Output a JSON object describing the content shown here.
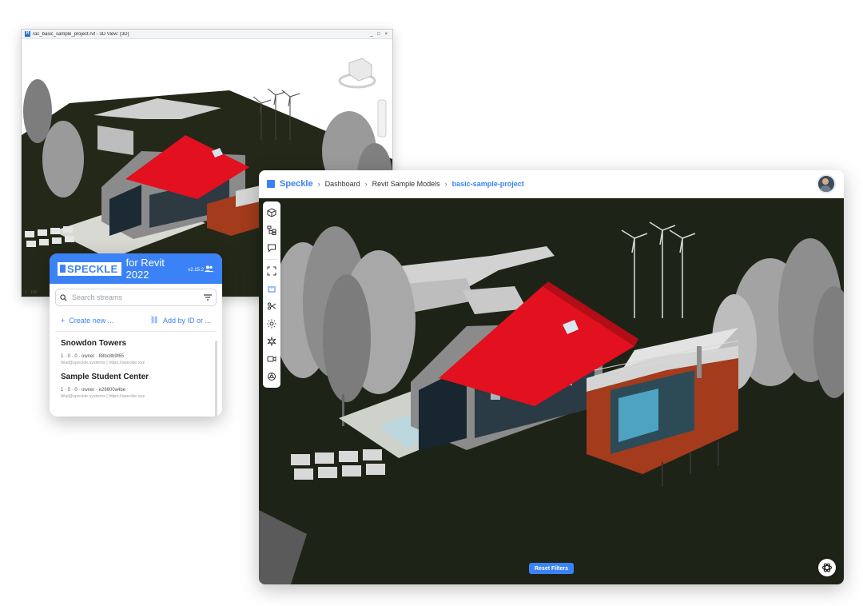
{
  "revit": {
    "window_title": "rac_basic_sample_project.rvt - 3D View: {3D}",
    "window_controls": "_ □ ×",
    "status_scale": "1 : 100"
  },
  "speckle_panel": {
    "logo": "SPECKLE",
    "product": "for Revit 2022",
    "version": "v2.15.2",
    "search_placeholder": "Search streams",
    "create_label": "Create new ...",
    "add_label": "Add by ID or ...",
    "streams": [
      {
        "name": "Snowdon Towers",
        "meta": "1 · 0 · 0 · owner · 88bc8b9f65",
        "user": "bilal@speckle.systems | https://speckle.xyz"
      },
      {
        "name": "Sample Student Center",
        "meta": "1 · 0 · 0 · owner · e28600a4be",
        "user": "bilal@speckle.systems | https://speckle.xyz"
      }
    ]
  },
  "viewer": {
    "brand": "Speckle",
    "breadcrumbs": [
      "Dashboard",
      "Revit Sample Models",
      "basic-sample-project"
    ],
    "reset_filters": "Reset Filters",
    "tools": [
      "cube-icon",
      "tree-icon",
      "comment-icon",
      "zoom-extents-icon",
      "measure-icon",
      "section-icon",
      "sun-icon",
      "explode-icon",
      "camera-icon",
      "settings-icon"
    ]
  },
  "colors": {
    "accent": "#3b82f6",
    "roof": "#e3101f",
    "cladding": "#a33b1c",
    "ground": "#1f2417"
  }
}
